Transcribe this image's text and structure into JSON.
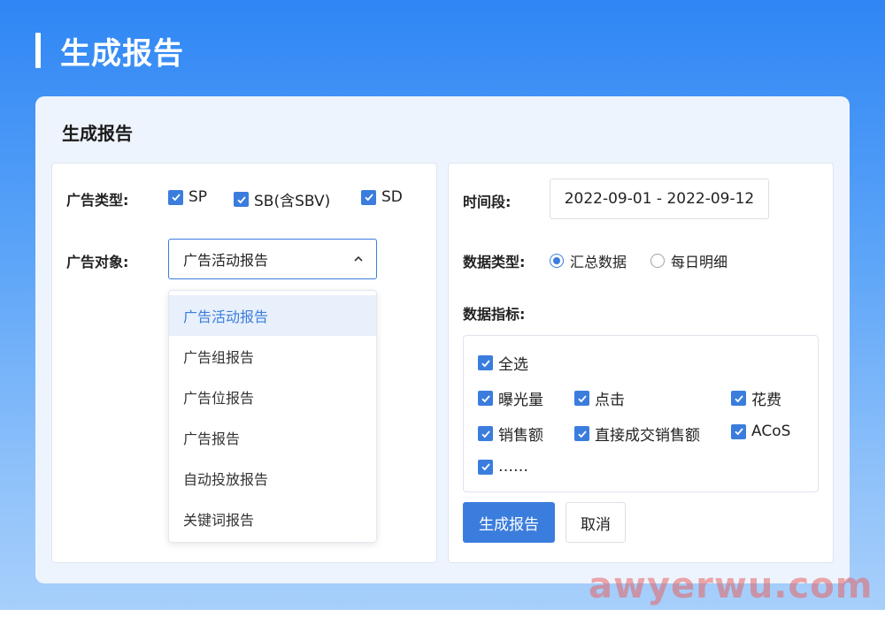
{
  "header": {
    "title": "生成报告"
  },
  "card": {
    "title": "生成报告"
  },
  "left_panel": {
    "ad_type_label": "广告类型:",
    "ad_types": [
      {
        "label": "SP",
        "checked": true
      },
      {
        "label": "SB(含SBV)",
        "checked": true
      },
      {
        "label": "SD",
        "checked": true
      }
    ],
    "ad_object_label": "广告对象:",
    "ad_object_selected": "广告活动报告",
    "ad_object_options": [
      "广告活动报告",
      "广告组报告",
      "广告位报告",
      "广告报告",
      "自动投放报告",
      "关键词报告"
    ]
  },
  "right_panel": {
    "time_label": "时间段:",
    "date_range": "2022-09-01 - 2022-09-12",
    "data_type_label": "数据类型:",
    "data_type_options": [
      {
        "label": "汇总数据",
        "checked": true
      },
      {
        "label": "每日明细",
        "checked": false
      }
    ],
    "metrics_label": "数据指标:",
    "metrics": {
      "select_all": "全选",
      "items": [
        "曝光量",
        "点击",
        "花费",
        "销售额",
        "直接成交销售额",
        "ACoS",
        "……"
      ]
    },
    "generate_button": "生成报告",
    "cancel_button": "取消"
  },
  "watermark": "awyerwu.com",
  "colors": {
    "primary": "#3b7ddd",
    "header_gradient_top": "#2f86f4"
  }
}
